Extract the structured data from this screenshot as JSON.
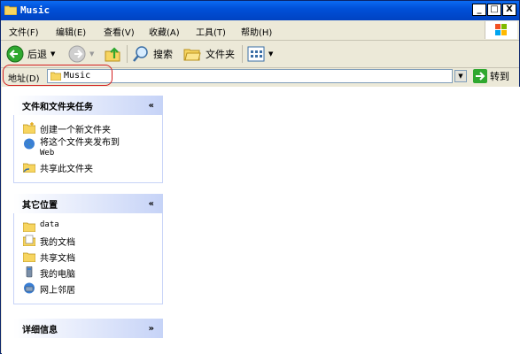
{
  "window": {
    "title": "Music"
  },
  "controls": {
    "minimize": "_",
    "maximize": "□",
    "close": "X"
  },
  "menu": [
    "文件(F)",
    "编辑(E)",
    "查看(V)",
    "收藏(A)",
    "工具(T)",
    "帮助(H)"
  ],
  "toolbar": {
    "back": "后退",
    "search": "搜索",
    "folders": "文件夹"
  },
  "address": {
    "label": "地址(D)",
    "value": "Music",
    "go": "转到"
  },
  "panels": {
    "tasks": {
      "title": "文件和文件夹任务",
      "items": [
        "创建一个新文件夹",
        "将这个文件夹发布到",
        "Web",
        "共享此文件夹"
      ]
    },
    "places": {
      "title": "其它位置",
      "items": [
        "data",
        "我的文档",
        "共享文档",
        "我的电脑",
        "网上邻居"
      ]
    },
    "details": {
      "title": "详细信息"
    }
  }
}
